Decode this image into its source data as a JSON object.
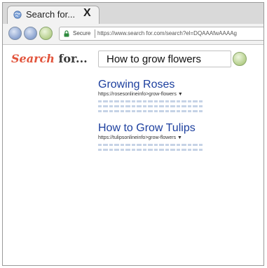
{
  "browser": {
    "tab": {
      "title": "Search for...",
      "close_glyph": "X",
      "favicon": "globe-icon"
    },
    "nav": {
      "back_icon": "back-arrow-icon",
      "forward_icon": "forward-arrow-icon",
      "reload_icon": "reload-icon"
    },
    "address_bar": {
      "security_label": "Secure",
      "url": "https://www.search for.com/search?el=DQAAAfwAAAAg"
    }
  },
  "page": {
    "logo": {
      "word1": "Search",
      "word2": "for..."
    },
    "search": {
      "query": "How to grow flowers",
      "submit_icon": "search-go-icon"
    },
    "results": [
      {
        "title": "Growing Roses",
        "url": "https://rosesonlineinfo>grow-flowers",
        "caret": "▼"
      },
      {
        "title": "How to Grow Tulips",
        "url": "https://tulipsonlineinfo>grow-flowers",
        "caret": "▼"
      }
    ]
  },
  "colors": {
    "logo_accent": "#e2543c",
    "link": "#1c3f9e",
    "tab_strip": "#d9d9d9",
    "toolbar": "#f2f2f2"
  }
}
